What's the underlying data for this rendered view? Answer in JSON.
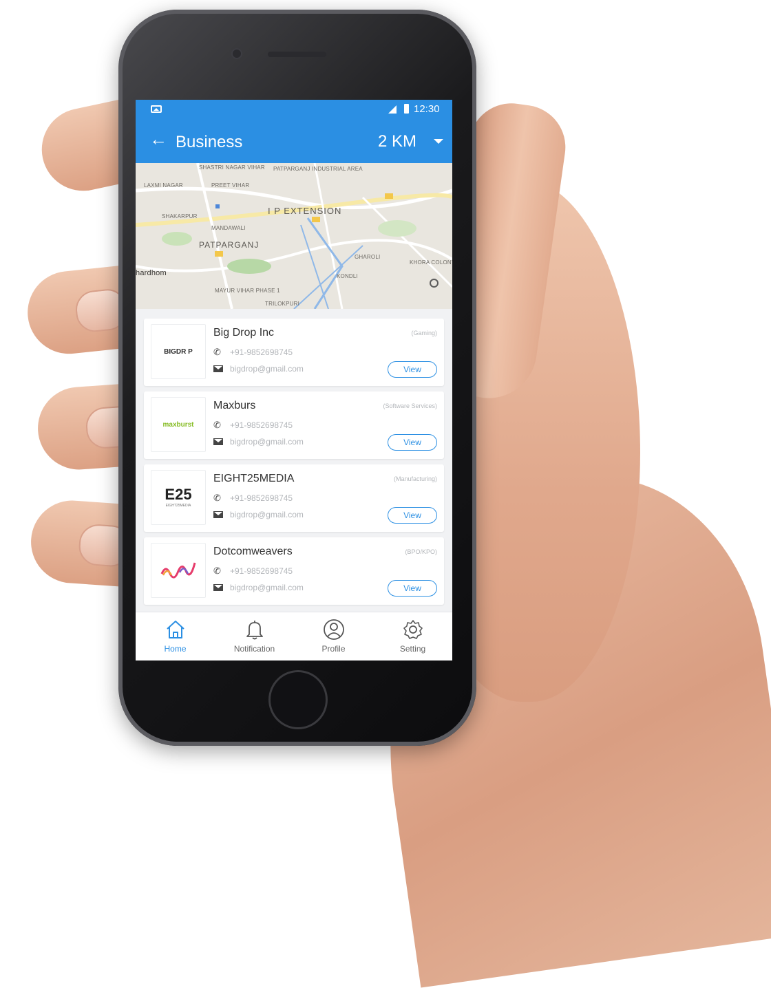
{
  "status_bar": {
    "time": "12:30"
  },
  "app_bar": {
    "title": "Business",
    "distance": "2 KM"
  },
  "map": {
    "labels": {
      "shastri_vihar": "SHASTRI NAGAR VIHAR",
      "patparganj_industrial": "PATPARGANJ INDUSTRIAL AREA",
      "laxmi_nagar": "LAXMI NAGAR",
      "preet_vihar": "PREET VIHAR",
      "shakarpur": "SHAKARPUR",
      "ip_extension": "I P EXTENSION",
      "mandawali": "MANDAWALI",
      "patparganj": "PATPARGANJ",
      "ghazipur": "GHAROLI",
      "kondli": "KONDLI",
      "khora_colony": "KHORA COLONY",
      "hardhom": "hardhom",
      "mayur_vihar": "MAYUR VIHAR PHASE 1",
      "trilokpuri": "TRILOKPURI"
    }
  },
  "businesses": [
    {
      "name": "Big Drop Inc",
      "category": "(Gaming)",
      "phone": "+91-9852698745",
      "email": "bigdrop@gmail.com",
      "logo": "BIGDR P",
      "view_label": "View"
    },
    {
      "name": "Maxburs",
      "category": "(Software Services)",
      "phone": "+91-9852698745",
      "email": "bigdrop@gmail.com",
      "logo": "maxburst",
      "view_label": "View"
    },
    {
      "name": "EIGHT25MEDIA",
      "category": "(Manufacturing)",
      "phone": "+91-9852698745",
      "email": "bigdrop@gmail.com",
      "logo": "E25",
      "logo_sub": "EIGHT25MEDIA",
      "view_label": "View"
    },
    {
      "name": "Dotcomweavers",
      "category": "(BPO/KPO)",
      "phone": "+91-9852698745",
      "email": "bigdrop@gmail.com",
      "logo": "dw",
      "view_label": "View"
    }
  ],
  "bottom_nav": {
    "items": [
      {
        "label": "Home",
        "icon": "home-icon",
        "active": true
      },
      {
        "label": "Notification",
        "icon": "bell-icon",
        "active": false
      },
      {
        "label": "Profile",
        "icon": "profile-icon",
        "active": false
      },
      {
        "label": "Setting",
        "icon": "gear-icon",
        "active": false
      }
    ]
  },
  "colors": {
    "primary": "#2b8fe3",
    "background": "#f1f2f4",
    "muted_text": "#b3b6ba"
  }
}
